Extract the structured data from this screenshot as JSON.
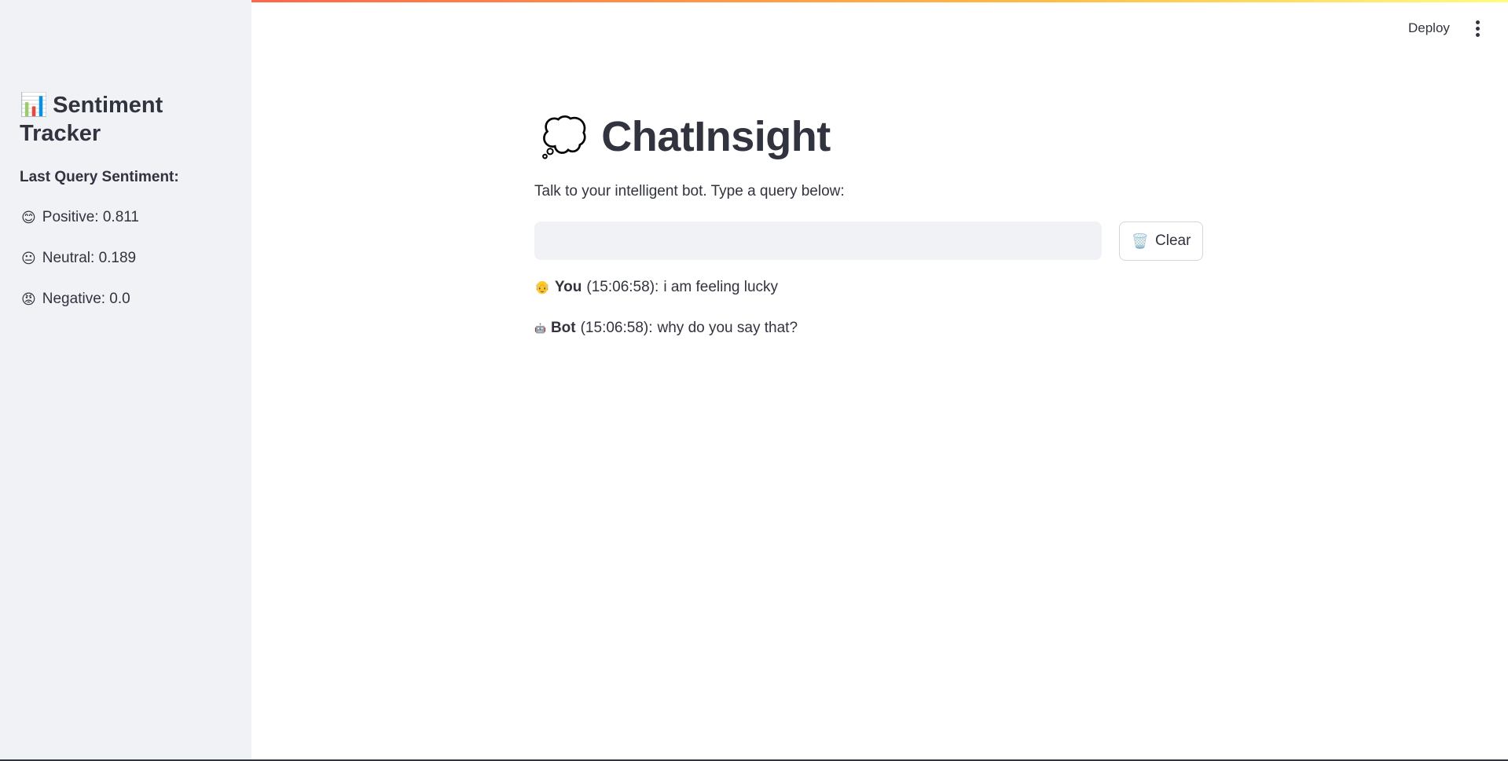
{
  "sidebar": {
    "title_icon": "📊",
    "title": "Sentiment Tracker",
    "heading": "Last Query Sentiment:",
    "items": [
      {
        "emoji": "😊",
        "label": "Positive: 0.811"
      },
      {
        "emoji": "😐",
        "label": "Neutral: 0.189"
      },
      {
        "emoji": "😡",
        "label": "Negative: 0.0"
      }
    ]
  },
  "header": {
    "deploy_label": "Deploy",
    "menu_icon": "vertical-ellipsis-icon"
  },
  "main": {
    "title_icon": "💭",
    "title": "ChatInsight",
    "subtitle": "Talk to your intelligent bot. Type a query below:",
    "input_value": "",
    "input_placeholder": "",
    "clear_icon": "🗑️",
    "clear_label": "Clear",
    "messages": [
      {
        "emoji": "👴",
        "who": "You",
        "time": "(15:06:58):",
        "text": "i am feeling lucky"
      },
      {
        "emoji": "🤖",
        "who": "Bot",
        "time": "(15:06:58):",
        "text": "why do you say that?"
      }
    ]
  },
  "colors": {
    "sidebar_bg": "#f0f2f6",
    "text": "#31333f",
    "accent_gradient_start": "#ff4b4b",
    "accent_gradient_end": "#fffd80"
  }
}
